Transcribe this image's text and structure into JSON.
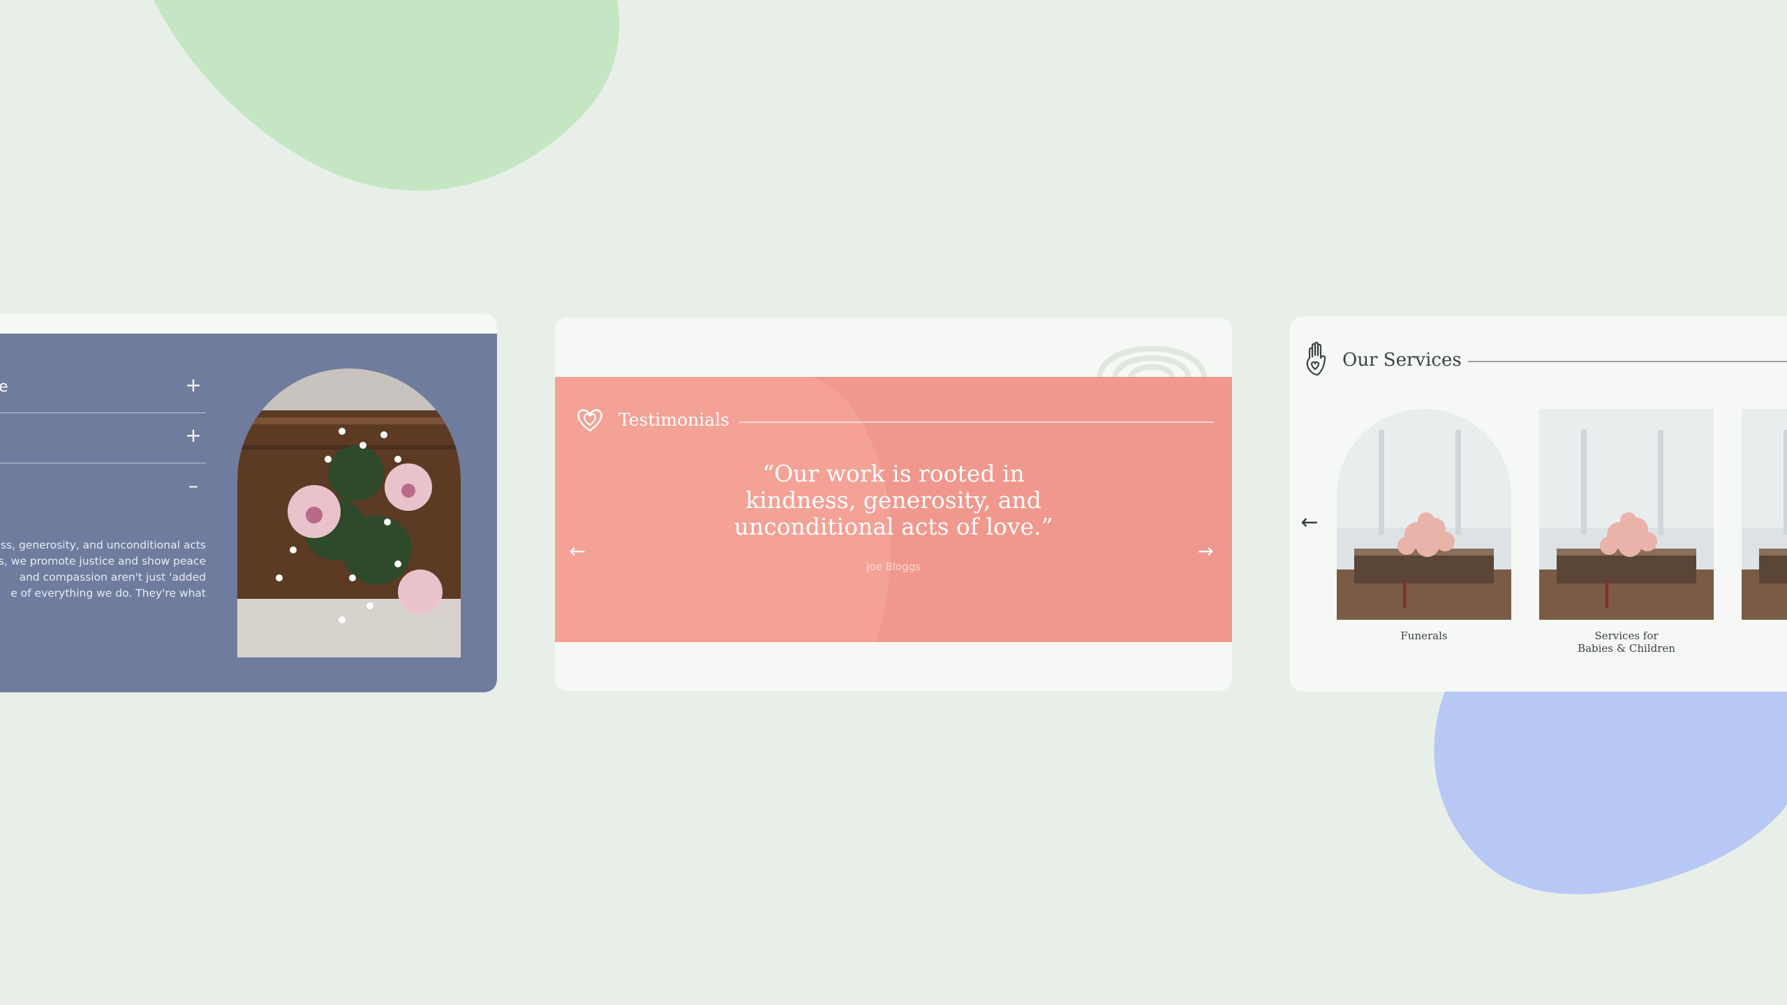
{
  "faq": {
    "items": [
      {
        "label": "e",
        "toggle": "+"
      },
      {
        "label": "",
        "toggle": "+"
      },
      {
        "label": "",
        "toggle": "–"
      }
    ],
    "expanded_text": [
      "ess, generosity, and unconditional acts",
      "s, we promote justice and show peace",
      "and compassion aren't just 'added",
      "e of everything we do. They're what"
    ]
  },
  "testimonials": {
    "title": "Testimonials",
    "quote": "“Our work is rooted in kindness, generosity, and unconditional acts of love.”",
    "author": "Joe Bloggs",
    "prev_arrow": "←",
    "next_arrow": "→"
  },
  "services": {
    "title": "Our Services",
    "prev_arrow": "←",
    "items": [
      {
        "label": "Funerals"
      },
      {
        "label": "Services for\nBabies & Children"
      },
      {
        "label": ""
      }
    ]
  },
  "colors": {
    "background": "#e8efe8",
    "blob_green": "#c5e6c2",
    "blob_blue": "#b7c8f5",
    "faq_panel": "#6f7c9e",
    "testimonial_panel": "#f4a196",
    "card": "#f6f8f5"
  }
}
